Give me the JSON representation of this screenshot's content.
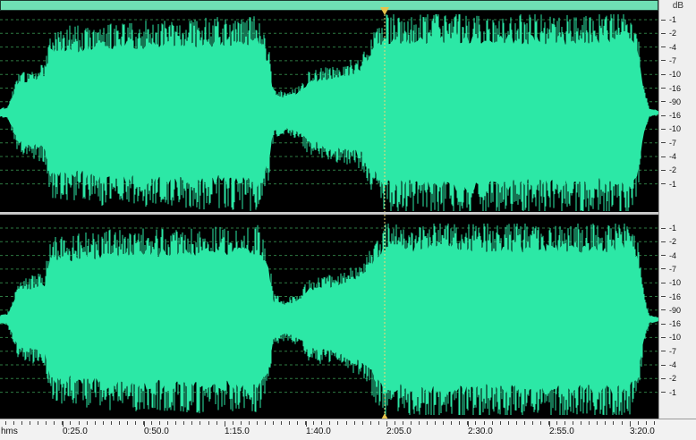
{
  "db_ruler": {
    "unit": "dB",
    "upper_channel_ticks": [
      "-1",
      "-2",
      "-4",
      "-7",
      "-10",
      "-16",
      "-90",
      "-16",
      "-10",
      "-7",
      "-4",
      "-2",
      "-1"
    ],
    "lower_channel_ticks": [
      "-1",
      "-2",
      "-4",
      "-7",
      "-10",
      "-16",
      "-90",
      "-16",
      "-10",
      "-7",
      "-4",
      "-2",
      "-1"
    ]
  },
  "timeline": {
    "unit_label": "hms",
    "labels": [
      "0:25.0",
      "0:50.0",
      "1:15.0",
      "1:40.0",
      "2:05.0",
      "2:30.0",
      "2:55.0",
      "3:20.0"
    ]
  },
  "colors": {
    "waveform": "#2ce8a6",
    "overview_bar": "#6fe0b4",
    "grid_line": "#2e7a42",
    "playhead": "#e6c24a",
    "background": "#000000",
    "ruler_background": "#efefef"
  },
  "playhead": {
    "time": "2:05.0"
  }
}
